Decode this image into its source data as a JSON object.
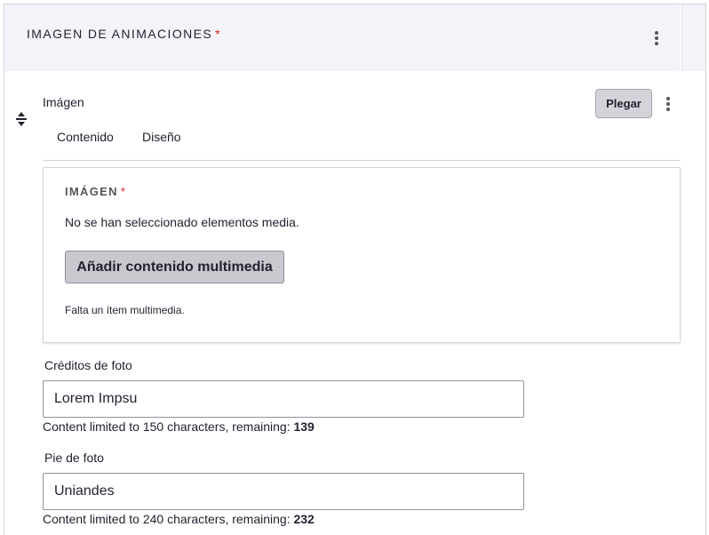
{
  "section": {
    "title": "IMAGEN DE ANIMACIONES",
    "required_mark": "*"
  },
  "item": {
    "label": "Imágen",
    "collapse_label": "Plegar"
  },
  "tabs": [
    {
      "label": "Contenido"
    },
    {
      "label": "Diseño"
    }
  ],
  "media": {
    "title": "IMÁGEN",
    "required_mark": "*",
    "empty_text": "No se han seleccionado elementos media.",
    "add_button_label": "Añadir contenido multimedia",
    "missing_text": "Falta un ítem multimedia."
  },
  "credits": {
    "label": "Créditos de foto",
    "value": "Lorem Impsu",
    "counter_text": "Content limited to 150 characters, remaining: ",
    "remaining": "139"
  },
  "caption": {
    "label": "Pie de foto",
    "value": "Uniandes",
    "counter_text": "Content limited to 240 characters, remaining: ",
    "remaining": "232"
  },
  "icons": {
    "section_menu": "kebab-menu-icon",
    "item_menu": "kebab-menu-icon",
    "drag": "drag-handle-icon"
  }
}
